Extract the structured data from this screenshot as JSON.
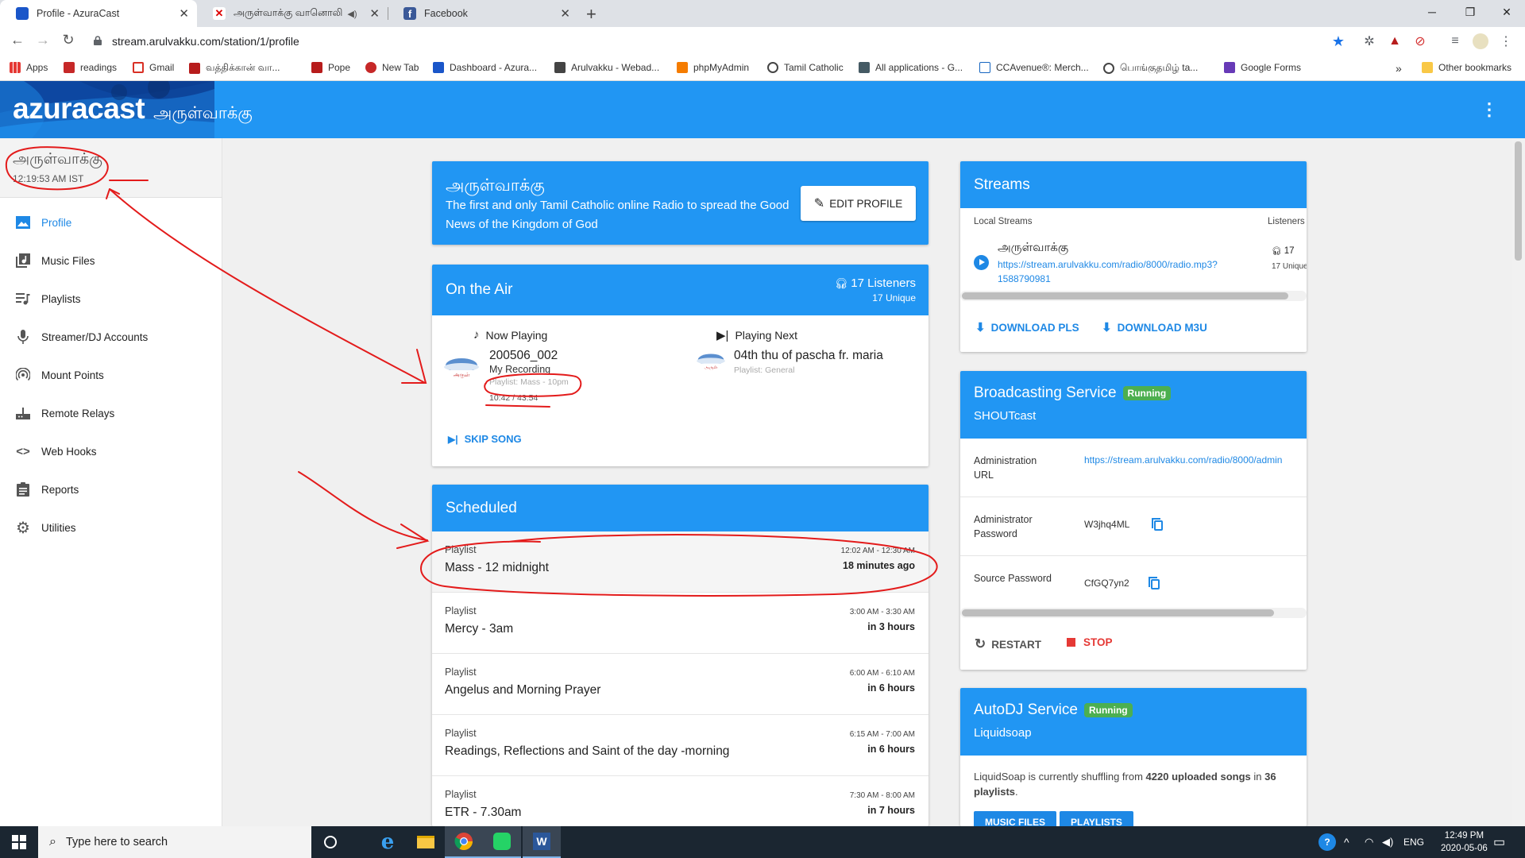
{
  "browser": {
    "tabs": [
      {
        "title": "Profile - AzuraCast",
        "active": true
      },
      {
        "title": "அருள்வாக்கு வானொலி",
        "active": false
      },
      {
        "title": "Facebook",
        "active": false
      }
    ],
    "url": "stream.arulvakku.com/station/1/profile",
    "bookmarks": [
      "Apps",
      "readings",
      "Gmail",
      "வத்திக்கான் வா...",
      "Pope",
      "New Tab",
      "Dashboard - Azura...",
      "Arulvakku - Webad...",
      "phpMyAdmin",
      "Tamil Catholic",
      "All applications - G...",
      "CCAvenue®: Merch...",
      "பொங்குதமிழ் ta...",
      "Google Forms"
    ],
    "bookmarks_more": "»",
    "other_bookmarks": "Other bookmarks"
  },
  "header": {
    "logo": "azuracast",
    "station": "அருள்வாக்கு"
  },
  "sidebar": {
    "station_name": "அருள்வாக்கு",
    "time": "12:19:53 AM IST",
    "items": [
      {
        "label": "Profile",
        "icon": "image-icon"
      },
      {
        "label": "Music Files",
        "icon": "library-music-icon"
      },
      {
        "label": "Playlists",
        "icon": "queue-music-icon"
      },
      {
        "label": "Streamer/DJ Accounts",
        "icon": "mic-icon"
      },
      {
        "label": "Mount Points",
        "icon": "wifi-tethering-icon"
      },
      {
        "label": "Remote Relays",
        "icon": "router-icon"
      },
      {
        "label": "Web Hooks",
        "icon": "code-icon"
      },
      {
        "label": "Reports",
        "icon": "assignment-icon"
      },
      {
        "label": "Utilities",
        "icon": "settings-icon"
      }
    ]
  },
  "profile": {
    "name": "அருள்வாக்கு",
    "description": "The first and only Tamil Catholic online Radio to spread the Good News of the Kingdom of God",
    "edit_label": "EDIT PROFILE"
  },
  "on_air": {
    "title": "On the Air",
    "listeners": "17 Listeners",
    "unique": "17 Unique",
    "now_playing": {
      "label": "Now Playing",
      "title": "200506_002",
      "artist": "My Recording",
      "playlist": "Playlist: Mass - 10pm",
      "time": "10:42 / 43:54"
    },
    "playing_next": {
      "label": "Playing Next",
      "title": "04th thu of pascha fr. maria",
      "playlist": "Playlist: General"
    },
    "skip_label": "SKIP SONG"
  },
  "scheduled": {
    "title": "Scheduled",
    "rows": [
      {
        "type": "Playlist",
        "name": "Mass - 12 midnight",
        "range": "12:02 AM - 12:30 AM",
        "relative": "18 minutes ago"
      },
      {
        "type": "Playlist",
        "name": "Mercy - 3am",
        "range": "3:00 AM - 3:30 AM",
        "relative": "in 3 hours"
      },
      {
        "type": "Playlist",
        "name": "Angelus and Morning Prayer",
        "range": "6:00 AM - 6:10 AM",
        "relative": "in 6 hours"
      },
      {
        "type": "Playlist",
        "name": "Readings, Reflections and Saint of the day -morning",
        "range": "6:15 AM - 7:00 AM",
        "relative": "in 6 hours"
      },
      {
        "type": "Playlist",
        "name": "ETR - 7.30am",
        "range": "7:30 AM - 8:00 AM",
        "relative": "in 7 hours"
      }
    ]
  },
  "streams": {
    "title": "Streams",
    "col_local": "Local Streams",
    "col_listeners": "Listeners",
    "stream_name": "அருள்வாக்கு",
    "stream_url": "https://stream.arulvakku.com/radio/8000/radio.mp3?1588790981",
    "stream_count": "17",
    "stream_unique": "17 Unique",
    "download_pls": "DOWNLOAD PLS",
    "download_m3u": "DOWNLOAD M3U"
  },
  "broadcasting": {
    "title": "Broadcasting Service",
    "status": "Running",
    "subtitle": "SHOUTcast",
    "rows": [
      {
        "key": "Administration URL",
        "value": "https://stream.arulvakku.com/radio/8000/admin"
      },
      {
        "key": "Administrator Password",
        "value": "W3jhq4ML"
      },
      {
        "key": "Source Password",
        "value": "CfGQ7yn2"
      }
    ],
    "restart_label": "RESTART",
    "stop_label": "STOP"
  },
  "autodj": {
    "title": "AutoDJ Service",
    "status": "Running",
    "subtitle": "Liquidsoap",
    "text_pre": "LiquidSoap is currently shuffling from ",
    "songs": "4220 uploaded songs",
    "text_mid": " in ",
    "playlists": "36 playlists",
    "text_post": ".",
    "buttons": [
      "MUSIC FILES",
      "PLAYLISTS"
    ]
  },
  "taskbar": {
    "search_placeholder": "Type here to search",
    "lang": "ENG",
    "time": "12:49 PM",
    "date": "2020-05-06"
  },
  "colors": {
    "primary": "#2196f3",
    "link": "#1e88e5",
    "running": "#4caf50",
    "stop": "#e53935",
    "annotation": "#e31b1b"
  }
}
